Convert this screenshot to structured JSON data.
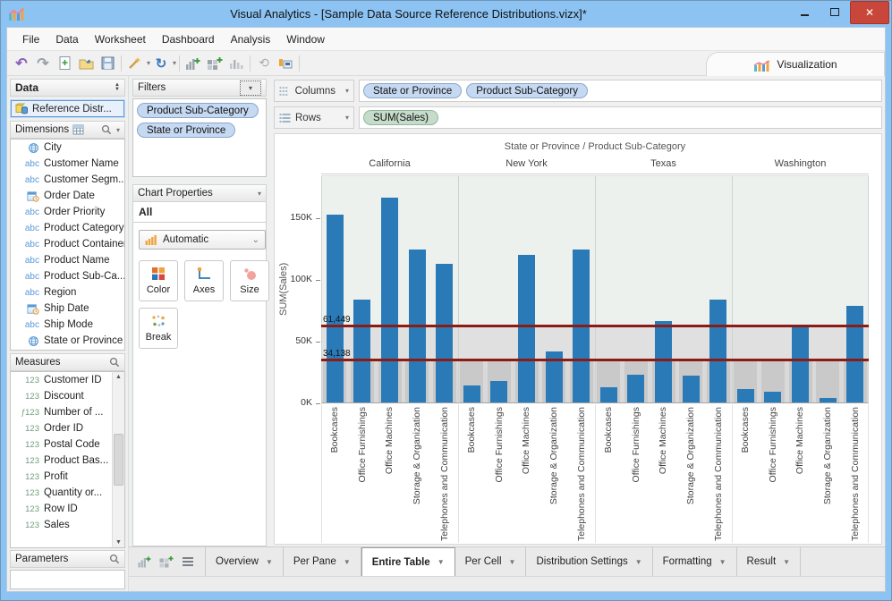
{
  "window": {
    "title": "Visual Analytics - [Sample Data Source Reference Distributions.vizx]*"
  },
  "menu": {
    "items": [
      "File",
      "Data",
      "Worksheet",
      "Dashboard",
      "Analysis",
      "Window"
    ]
  },
  "toolbar": {
    "visualization_tab": "Visualization"
  },
  "data_panel": {
    "header": "Data",
    "datasource": {
      "label": "Reference Distr...",
      "icon": "database-icon"
    },
    "dimensions": {
      "header": "Dimensions",
      "items": [
        {
          "icon": "globe",
          "label": "City"
        },
        {
          "icon": "abc",
          "label": "Customer Name"
        },
        {
          "icon": "abc",
          "label": "Customer Segm..."
        },
        {
          "icon": "calendar",
          "label": "Order Date"
        },
        {
          "icon": "abc",
          "label": "Order Priority"
        },
        {
          "icon": "abc",
          "label": "Product Category"
        },
        {
          "icon": "abc",
          "label": "Product Container"
        },
        {
          "icon": "abc",
          "label": "Product Name"
        },
        {
          "icon": "abc",
          "label": "Product Sub-Ca..."
        },
        {
          "icon": "abc",
          "label": "Region"
        },
        {
          "icon": "calendar",
          "label": "Ship Date"
        },
        {
          "icon": "abc",
          "label": "Ship Mode"
        },
        {
          "icon": "globe",
          "label": "State or Province"
        }
      ]
    },
    "measures": {
      "header": "Measures",
      "items": [
        {
          "icon": "123",
          "label": "Customer ID"
        },
        {
          "icon": "123",
          "label": "Discount"
        },
        {
          "icon": "f123",
          "label": "Number of ..."
        },
        {
          "icon": "123",
          "label": "Order ID"
        },
        {
          "icon": "123",
          "label": "Postal Code"
        },
        {
          "icon": "123",
          "label": "Product Bas..."
        },
        {
          "icon": "123",
          "label": "Profit"
        },
        {
          "icon": "123",
          "label": "Quantity or..."
        },
        {
          "icon": "123",
          "label": "Row ID"
        },
        {
          "icon": "123",
          "label": "Sales"
        }
      ]
    },
    "parameters": {
      "header": "Parameters"
    }
  },
  "filters_panel": {
    "header": "Filters",
    "pills": [
      "Product Sub-Category",
      "State or Province"
    ]
  },
  "chart_properties": {
    "header": "Chart Properties",
    "scope": "All",
    "mark_type": "Automatic",
    "buttons": [
      {
        "label": "Color",
        "icon": "color"
      },
      {
        "label": "Axes",
        "icon": "axes"
      },
      {
        "label": "Size",
        "icon": "size"
      },
      {
        "label": "Break",
        "icon": "break"
      }
    ]
  },
  "shelves": {
    "columns": {
      "label": "Columns",
      "pills": [
        "State or Province",
        "Product Sub-Category"
      ]
    },
    "rows": {
      "label": "Rows",
      "pills": [
        "SUM(Sales)"
      ]
    }
  },
  "chart_data": {
    "type": "bar",
    "title": "State or Province / Product Sub-Category",
    "ylabel": "SUM(Sales)",
    "ylim": [
      0,
      184500
    ],
    "grid": false,
    "yticks": [
      {
        "label": "0K",
        "value": 0
      },
      {
        "label": "50K",
        "value": 50000
      },
      {
        "label": "100K",
        "value": 100000
      },
      {
        "label": "150K",
        "value": 150000
      }
    ],
    "categories": [
      "Bookcases",
      "Office Furnishings",
      "Office Machines",
      "Storage & Organization",
      "Telephones and Communication"
    ],
    "series": [
      {
        "name": "California",
        "values": [
          152000,
          83500,
          166000,
          124000,
          112000
        ]
      },
      {
        "name": "New York",
        "values": [
          13500,
          17500,
          119500,
          41000,
          123500
        ]
      },
      {
        "name": "Texas",
        "values": [
          12500,
          22500,
          65500,
          21500,
          83500
        ]
      },
      {
        "name": "Washington",
        "values": [
          11000,
          8500,
          61500,
          3500,
          78500
        ]
      }
    ],
    "reference_lines": [
      {
        "label": "61,449",
        "value": 61449
      },
      {
        "label": "34,138",
        "value": 34138
      }
    ],
    "colors": {
      "bar": "#2a7ab8",
      "reference_line": "#8c1b14",
      "plot_bg": "#edf1ee",
      "band_mid": "#e0e0e0",
      "band_low": "#d9d9d9",
      "band_strip": "#c9c9c9"
    }
  },
  "bottom_tabs": {
    "active": "Entire Table",
    "tabs": [
      "Overview",
      "Per Pane",
      "Entire Table",
      "Per Cell",
      "Distribution Settings",
      "Formatting",
      "Result"
    ]
  }
}
